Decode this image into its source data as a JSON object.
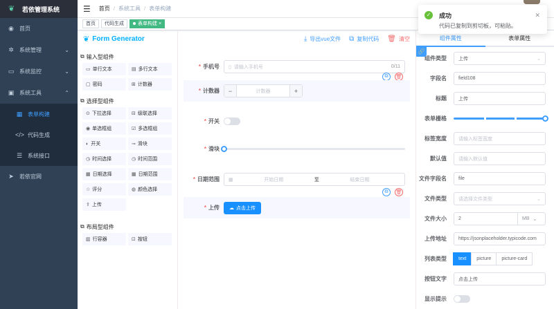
{
  "app": {
    "title": "若依管理系统"
  },
  "sidebar": {
    "items": [
      {
        "label": "首页",
        "icon": "dashboard-icon"
      },
      {
        "label": "系统管理",
        "icon": "gear-icon"
      },
      {
        "label": "系统监控",
        "icon": "monitor-icon"
      },
      {
        "label": "系统工具",
        "icon": "toolbox-icon"
      }
    ],
    "sub": [
      {
        "label": "表单构建"
      },
      {
        "label": "代码生成"
      },
      {
        "label": "系统接口"
      }
    ],
    "last": {
      "label": "若依官网"
    }
  },
  "breadcrumb": {
    "home": "首页",
    "section": "系统工具",
    "current": "表单构建"
  },
  "tags": [
    "首页",
    "代码生成",
    "表单构建"
  ],
  "toast": {
    "title": "成功",
    "message": "代码已复制到剪切板，可粘贴。"
  },
  "left": {
    "title": "Form Generator",
    "groups": [
      {
        "title": "输入型组件",
        "items": [
          "单行文本",
          "多行文本",
          "密码",
          "计数器"
        ]
      },
      {
        "title": "选择型组件",
        "items": [
          "下拉选择",
          "级联选择",
          "单选框组",
          "多选框组",
          "开关",
          "滑块",
          "时间选择",
          "时间范围",
          "日期选择",
          "日期范围",
          "评分",
          "颜色选择",
          "上传"
        ]
      },
      {
        "title": "布局型组件",
        "items": [
          "行容器",
          "按钮"
        ]
      }
    ]
  },
  "center": {
    "actions": {
      "export": "导出vue文件",
      "copy": "复制代码",
      "clear": "清空"
    },
    "fields": {
      "phone": {
        "label": "手机号",
        "placeholder": "请输入手机号",
        "counter": "0/11"
      },
      "counter": {
        "label": "计数器",
        "placeholder": "计数器",
        "minus": "−",
        "plus": "+"
      },
      "switch": {
        "label": "开关"
      },
      "slider": {
        "label": "滑块"
      },
      "daterange": {
        "label": "日期范围",
        "start": "开始日期",
        "to": "至",
        "end": "结束日期"
      },
      "upload": {
        "label": "上传",
        "button": "点击上传"
      }
    }
  },
  "right": {
    "tabs": [
      "组件属性",
      "表单属性"
    ],
    "rows": {
      "type": {
        "label": "组件类型",
        "value": "上传"
      },
      "field": {
        "label": "字段名",
        "value": "field108"
      },
      "title": {
        "label": "标题",
        "value": "上传"
      },
      "grid": {
        "label": "表单栅格",
        "value": 24
      },
      "labelWidth": {
        "label": "标签宽度",
        "placeholder": "请输入标签宽度"
      },
      "default": {
        "label": "默认值",
        "placeholder": "请输入默认值"
      },
      "fileField": {
        "label": "文件字段名",
        "value": "file"
      },
      "fileType": {
        "label": "文件类型",
        "placeholder": "请选择文件类型"
      },
      "fileSize": {
        "label": "文件大小",
        "value": "2",
        "unit": "MB"
      },
      "action": {
        "label": "上传地址",
        "value": "https://jsonplaceholder.typicode.com"
      },
      "listType": {
        "label": "列表类型",
        "options": [
          "text",
          "picture",
          "picture-card"
        ],
        "selected": "text"
      },
      "btnText": {
        "label": "按钮文字",
        "value": "点击上传"
      },
      "showTip": {
        "label": "显示提示"
      }
    }
  }
}
